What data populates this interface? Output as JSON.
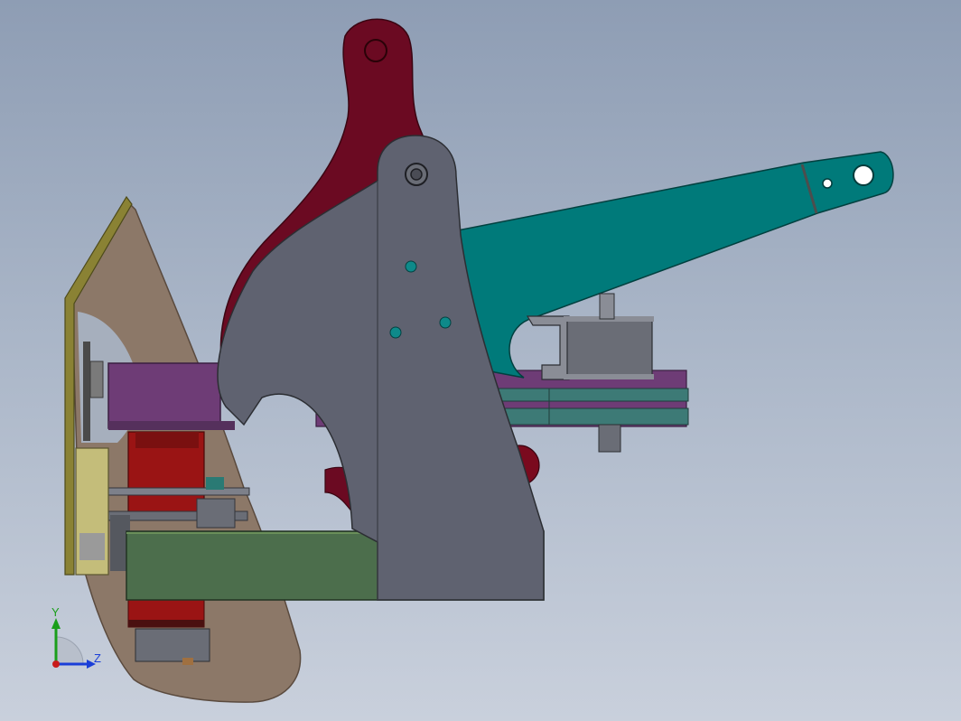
{
  "viewport": {
    "background_top": "#8e9db4",
    "background_bottom": "#c9d0dc"
  },
  "model_colors": {
    "crank_lever": "#6b0a22",
    "side_plate": "#5f6270",
    "arm": "#007a7a",
    "guard_plate": "#8c7868",
    "guard_edge": "#6e6a2c",
    "block": "#6e3c76",
    "base_beam": "#4c6e4c",
    "spring": "#9a1414",
    "roller": "#6a6d76",
    "hole_teal": "#0e8a8a",
    "hole_red": "#8a0e2a"
  },
  "triad": {
    "y_label": "Y",
    "z_label": "Z",
    "y_color": "#1a9e1a",
    "z_color": "#1a3ed8",
    "origin_color": "#c81a1a"
  }
}
